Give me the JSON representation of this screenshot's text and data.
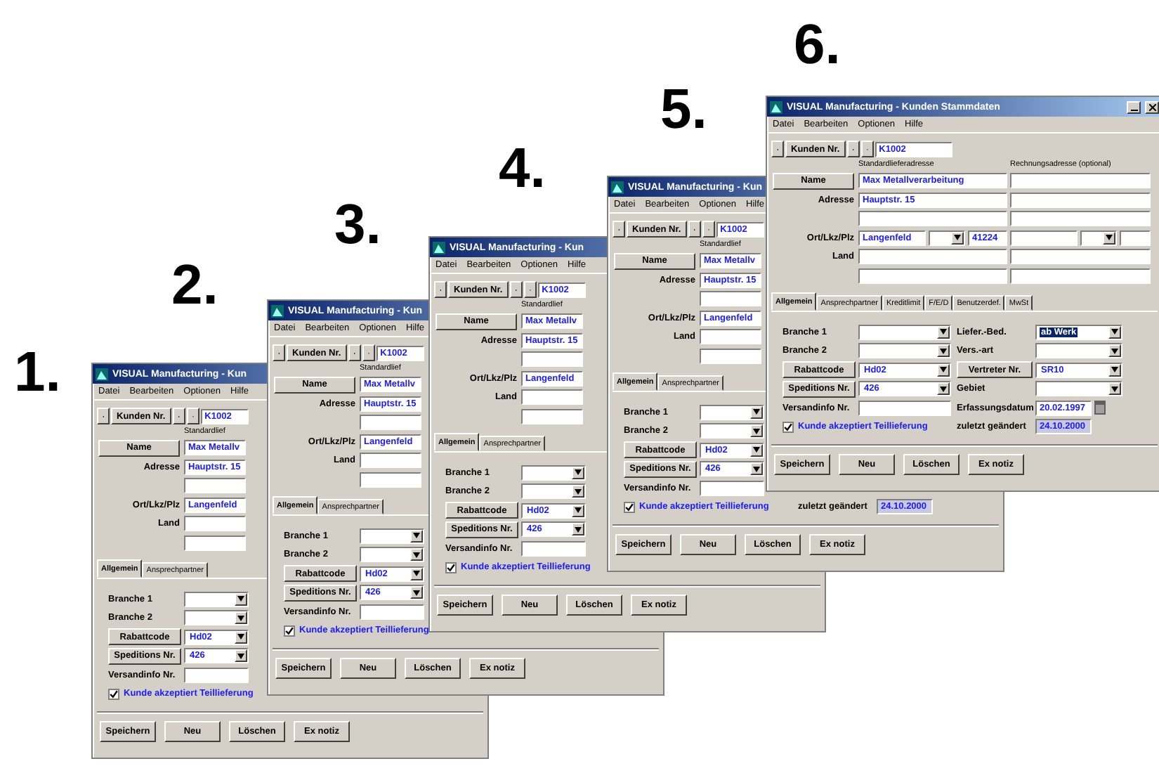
{
  "figure_labels": [
    "1.",
    "2.",
    "3.",
    "4.",
    "5.",
    "6."
  ],
  "windows": [
    {
      "title": "VISUAL Manufacturing - Kun",
      "menu": [
        "Datei",
        "Bearbeiten",
        "Optionen",
        "Hilfe"
      ],
      "nav": {
        "button": "Kunden Nr.",
        "value": "K1002"
      },
      "headings": [
        "Standardlief"
      ],
      "address_rows": [
        {
          "kind": "button",
          "label": "Name",
          "value": "Max Metallv"
        },
        {
          "kind": "label",
          "label": "Adresse",
          "value": "Hauptstr. 15"
        },
        {
          "kind": "blank"
        },
        {
          "kind": "city",
          "label": "Ort/Lkz/Plz",
          "value": "Langenfeld"
        },
        {
          "kind": "label",
          "label": "Land"
        },
        {
          "kind": "blank"
        }
      ],
      "tabs": [
        {
          "label": "Allgemein",
          "selected": true
        },
        {
          "label": "Ansprechpartner",
          "selected": false
        }
      ],
      "panel_rows": [
        {
          "left": {
            "kind": "combo",
            "label": "Branche 1"
          }
        },
        {
          "left": {
            "kind": "combo",
            "label": "Branche 2"
          }
        },
        {
          "left": {
            "kind": "button-combo",
            "label": "Rabattcode",
            "value": "Hd02"
          }
        },
        {
          "left": {
            "kind": "button-combo",
            "label": "Speditions Nr.",
            "value": "426"
          }
        },
        {
          "left": {
            "kind": "input",
            "label": "Versandinfo Nr."
          }
        },
        {
          "left": {
            "kind": "checkbox",
            "label": "Kunde akzeptiert Teillieferung",
            "checked": true
          }
        }
      ],
      "buttons": [
        "Speichern",
        "Neu",
        "Löschen",
        "Ex notiz"
      ]
    },
    {
      "title": "VISUAL Manufacturing - Kun",
      "menu": [
        "Datei",
        "Bearbeiten",
        "Optionen",
        "Hilfe"
      ],
      "nav": {
        "button": "Kunden Nr.",
        "value": "K1002"
      },
      "headings": [
        "Standardlief"
      ],
      "address_rows": [
        {
          "kind": "button",
          "label": "Name",
          "value": "Max Metallv"
        },
        {
          "kind": "label",
          "label": "Adresse",
          "value": "Hauptstr. 15"
        },
        {
          "kind": "blank"
        },
        {
          "kind": "city",
          "label": "Ort/Lkz/Plz",
          "value": "Langenfeld"
        },
        {
          "kind": "label",
          "label": "Land"
        },
        {
          "kind": "blank"
        }
      ],
      "tabs": [
        {
          "label": "Allgemein",
          "selected": true
        },
        {
          "label": "Ansprechpartner",
          "selected": false
        }
      ],
      "panel_rows": [
        {
          "left": {
            "kind": "combo",
            "label": "Branche 1"
          }
        },
        {
          "left": {
            "kind": "combo",
            "label": "Branche 2"
          }
        },
        {
          "left": {
            "kind": "button-combo",
            "label": "Rabattcode",
            "value": "Hd02"
          }
        },
        {
          "left": {
            "kind": "button-combo",
            "label": "Speditions Nr.",
            "value": "426"
          }
        },
        {
          "left": {
            "kind": "input",
            "label": "Versandinfo Nr."
          }
        },
        {
          "left": {
            "kind": "checkbox",
            "label": "Kunde akzeptiert Teillieferung",
            "checked": true
          }
        }
      ],
      "buttons": [
        "Speichern",
        "Neu",
        "Löschen",
        "Ex notiz"
      ]
    },
    {
      "title": "VISUAL Manufacturing - Kun",
      "menu": [
        "Datei",
        "Bearbeiten",
        "Optionen",
        "Hilfe"
      ],
      "nav": {
        "button": "Kunden Nr.",
        "value": "K1002"
      },
      "headings": [
        "Standardlief"
      ],
      "address_rows": [
        {
          "kind": "button",
          "label": "Name",
          "value": "Max Metallv"
        },
        {
          "kind": "label",
          "label": "Adresse",
          "value": "Hauptstr. 15"
        },
        {
          "kind": "blank"
        },
        {
          "kind": "city",
          "label": "Ort/Lkz/Plz",
          "value": "Langenfeld"
        },
        {
          "kind": "label",
          "label": "Land"
        },
        {
          "kind": "blank"
        }
      ],
      "tabs": [
        {
          "label": "Allgemein",
          "selected": true
        },
        {
          "label": "Ansprechpartner",
          "selected": false
        }
      ],
      "panel_rows": [
        {
          "left": {
            "kind": "combo",
            "label": "Branche 1"
          }
        },
        {
          "left": {
            "kind": "combo",
            "label": "Branche 2"
          }
        },
        {
          "left": {
            "kind": "button-combo",
            "label": "Rabattcode",
            "value": "Hd02"
          }
        },
        {
          "left": {
            "kind": "button-combo",
            "label": "Speditions Nr.",
            "value": "426"
          }
        },
        {
          "left": {
            "kind": "input",
            "label": "Versandinfo Nr."
          }
        },
        {
          "left": {
            "kind": "checkbox",
            "label": "Kunde akzeptiert Teillieferung",
            "checked": true
          }
        }
      ],
      "buttons": [
        "Speichern",
        "Neu",
        "Löschen",
        "Ex notiz"
      ]
    },
    {
      "title": "VISUAL Manufacturing - Kun",
      "menu": [
        "Datei",
        "Bearbeiten",
        "Optionen",
        "Hilfe"
      ],
      "nav": {
        "button": "Kunden Nr.",
        "value": "K1002"
      },
      "headings": [
        "Standardlief"
      ],
      "address_rows": [
        {
          "kind": "button",
          "label": "Name",
          "value": "Max Metallv"
        },
        {
          "kind": "label",
          "label": "Adresse",
          "value": "Hauptstr. 15"
        },
        {
          "kind": "blank"
        },
        {
          "kind": "city",
          "label": "Ort/Lkz/Plz",
          "value": "Langenfeld"
        },
        {
          "kind": "label",
          "label": "Land"
        },
        {
          "kind": "blank"
        }
      ],
      "tabs": [
        {
          "label": "Allgemein",
          "selected": true
        },
        {
          "label": "Ansprechpartner",
          "selected": false
        }
      ],
      "panel_rows": [
        {
          "left": {
            "kind": "combo",
            "label": "Branche 1"
          }
        },
        {
          "left": {
            "kind": "combo",
            "label": "Branche 2"
          }
        },
        {
          "left": {
            "kind": "button-combo",
            "label": "Rabattcode",
            "value": "Hd02"
          }
        },
        {
          "left": {
            "kind": "button-combo",
            "label": "Speditions Nr.",
            "value": "426"
          }
        },
        {
          "left": {
            "kind": "input",
            "label": "Versandinfo Nr."
          }
        },
        {
          "left": {
            "kind": "checkbox",
            "label": "Kunde akzeptiert Teillieferung",
            "checked": true
          },
          "right": {
            "kind": "readonly",
            "label": "zuletzt geändert",
            "value": "24.10.2000"
          }
        }
      ],
      "buttons": [
        "Speichern",
        "Neu",
        "Löschen",
        "Ex notiz"
      ]
    },
    {
      "title": "VISUAL Manufacturing - Kunden Stammdaten",
      "window_controls": true,
      "billing_column": true,
      "menu": [
        "Datei",
        "Bearbeiten",
        "Optionen",
        "Hilfe"
      ],
      "nav": {
        "button": "Kunden Nr.",
        "value": "K1002"
      },
      "headings": [
        "Standardlieferadresse",
        "Rechnungsadresse (optional)"
      ],
      "address_rows": [
        {
          "kind": "button",
          "label": "Name",
          "value": "Max Metallverarbeitung"
        },
        {
          "kind": "label",
          "label": "Adresse",
          "value": "Hauptstr. 15"
        },
        {
          "kind": "blank"
        },
        {
          "kind": "city",
          "label": "Ort/Lkz/Plz",
          "value": "Langenfeld",
          "zip": "41224"
        },
        {
          "kind": "label",
          "label": "Land"
        },
        {
          "kind": "blank"
        }
      ],
      "tabs": [
        {
          "label": "Allgemein",
          "selected": true
        },
        {
          "label": "Ansprechpartner",
          "selected": false
        },
        {
          "label": "Kreditlimit",
          "selected": false
        },
        {
          "label": "F/E/D",
          "selected": false
        },
        {
          "label": "Benutzerdef.",
          "selected": false
        },
        {
          "label": "MwSt",
          "selected": false
        }
      ],
      "panel_rows": [
        {
          "left": {
            "kind": "combo",
            "label": "Branche 1"
          },
          "right": {
            "kind": "combo",
            "label": "Liefer.-Bed.",
            "value": "ab Werk",
            "highlighted": true
          }
        },
        {
          "left": {
            "kind": "combo",
            "label": "Branche 2"
          },
          "right": {
            "kind": "combo",
            "label": "Vers.-art"
          }
        },
        {
          "left": {
            "kind": "button-combo",
            "label": "Rabattcode",
            "value": "Hd02"
          },
          "right": {
            "kind": "button-combo",
            "label": "Vertreter Nr.",
            "value": "SR10"
          }
        },
        {
          "left": {
            "kind": "button-combo",
            "label": "Speditions Nr.",
            "value": "426"
          },
          "right": {
            "kind": "combo",
            "label": "Gebiet"
          }
        },
        {
          "left": {
            "kind": "input",
            "label": "Versandinfo Nr."
          },
          "right": {
            "kind": "date",
            "label": "Erfassungsdatum",
            "value": "20.02.1997"
          }
        },
        {
          "left": {
            "kind": "checkbox",
            "label": "Kunde akzeptiert Teillieferung",
            "checked": true
          },
          "right": {
            "kind": "readonly",
            "label": "zuletzt geändert",
            "value": "24.10.2000"
          }
        }
      ],
      "buttons": [
        "Speichern",
        "Neu",
        "Löschen",
        "Ex notiz"
      ]
    }
  ]
}
